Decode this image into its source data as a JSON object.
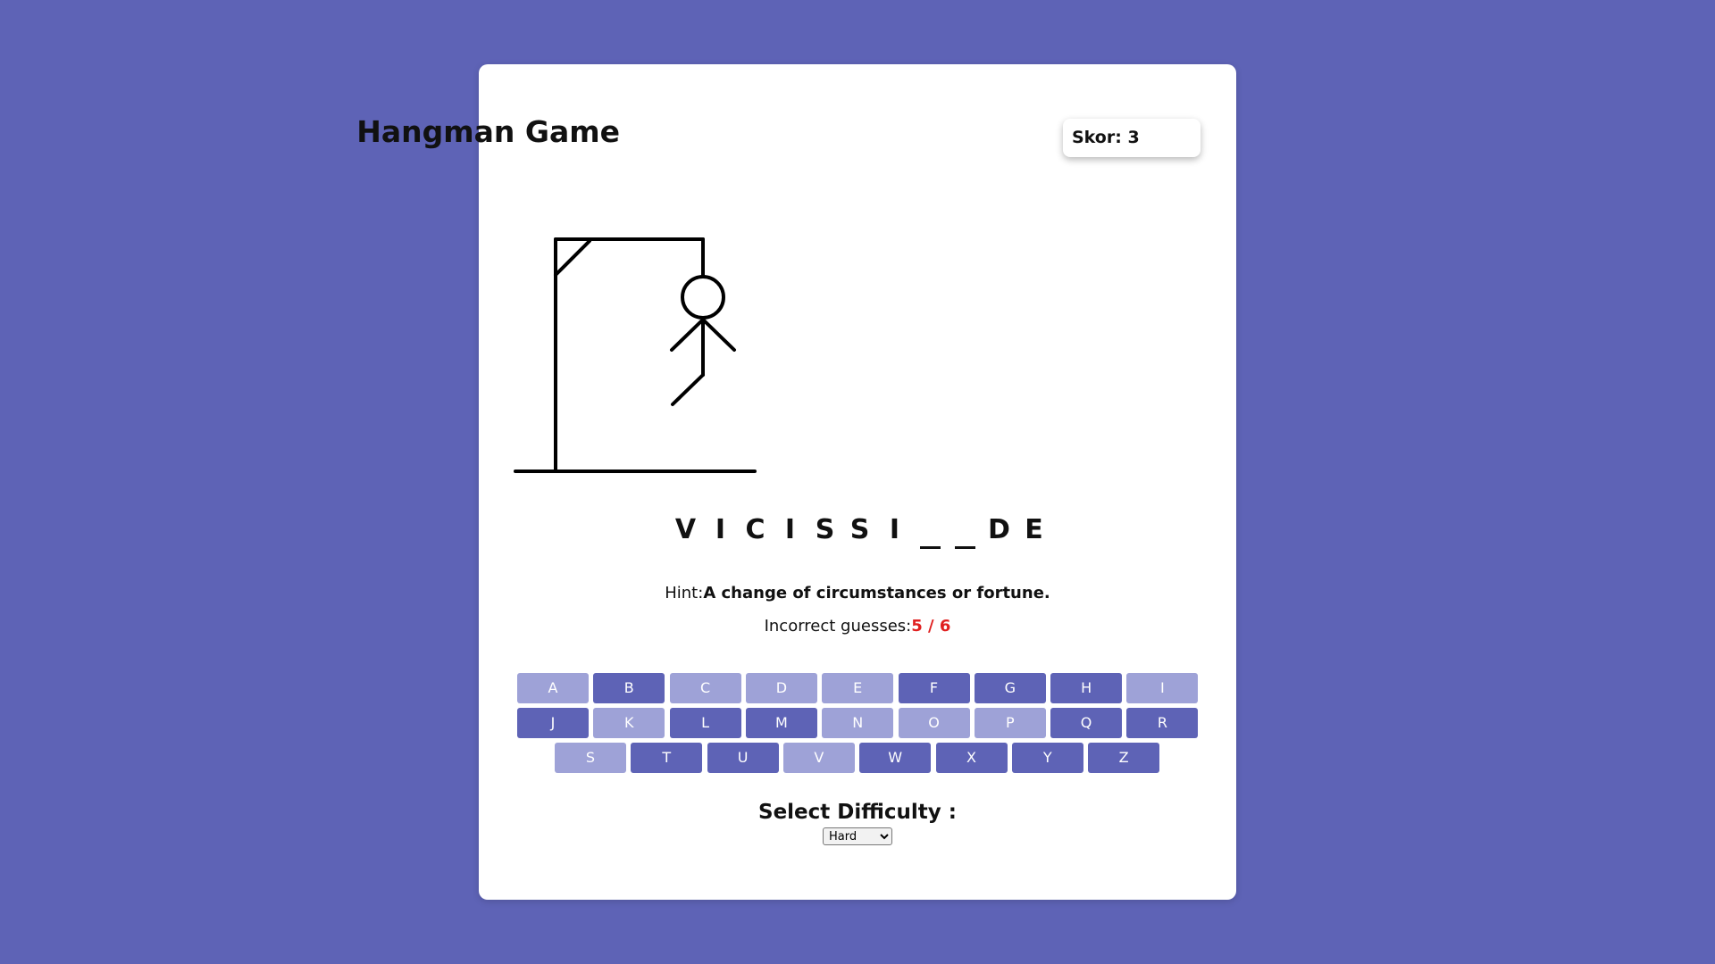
{
  "header": {
    "title": "Hangman Game",
    "score_label": "Skor: 3"
  },
  "word": {
    "slots": [
      "V",
      "I",
      "C",
      "I",
      "S",
      "S",
      "I",
      "",
      "",
      "D",
      "E"
    ]
  },
  "hint": {
    "label": "Hint:",
    "text": "A change of circumstances or fortune."
  },
  "guesses": {
    "label": "Incorrect guesses:",
    "count": "5 / 6"
  },
  "keyboard": {
    "rows": [
      [
        {
          "letter": "A",
          "used": true
        },
        {
          "letter": "B",
          "used": false
        },
        {
          "letter": "C",
          "used": true
        },
        {
          "letter": "D",
          "used": true
        },
        {
          "letter": "E",
          "used": true
        },
        {
          "letter": "F",
          "used": false
        },
        {
          "letter": "G",
          "used": false
        },
        {
          "letter": "H",
          "used": false
        },
        {
          "letter": "I",
          "used": true
        }
      ],
      [
        {
          "letter": "J",
          "used": false
        },
        {
          "letter": "K",
          "used": true
        },
        {
          "letter": "L",
          "used": false
        },
        {
          "letter": "M",
          "used": false
        },
        {
          "letter": "N",
          "used": true
        },
        {
          "letter": "O",
          "used": true
        },
        {
          "letter": "P",
          "used": true
        },
        {
          "letter": "Q",
          "used": false
        },
        {
          "letter": "R",
          "used": false
        }
      ],
      [
        {
          "letter": "S",
          "used": true
        },
        {
          "letter": "T",
          "used": false
        },
        {
          "letter": "U",
          "used": false
        },
        {
          "letter": "V",
          "used": true
        },
        {
          "letter": "W",
          "used": false
        },
        {
          "letter": "X",
          "used": false
        },
        {
          "letter": "Y",
          "used": false
        },
        {
          "letter": "Z",
          "used": false
        }
      ]
    ]
  },
  "difficulty": {
    "label": "Select Difficulty :",
    "selected": "Hard"
  },
  "colors": {
    "background": "#5e63b6",
    "key_active": "#5e63b6",
    "key_used": "#9ea2d7",
    "guess_count": "#e02020"
  }
}
